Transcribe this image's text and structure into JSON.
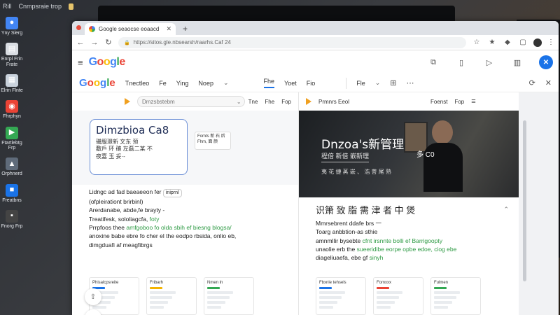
{
  "desktop": {
    "topbar": [
      "Rill",
      "Cnmpsraie trop"
    ],
    "icons": [
      {
        "label": "Yny Slerg",
        "color": "#4285f4",
        "glyph": "●"
      },
      {
        "label": "Enrpl Frin\nFrate",
        "color": "#d9dde3",
        "glyph": "▤"
      },
      {
        "label": "Elrin\nFlnte",
        "color": "#c9d2dc",
        "glyph": "▦"
      },
      {
        "label": "Fhrphyn",
        "color": "#ea4335",
        "glyph": "◉"
      },
      {
        "label": "Ftartlebtg\nFrp",
        "color": "#34a853",
        "glyph": "▶"
      },
      {
        "label": "Orphnerd",
        "color": "#5f6b7a",
        "glyph": "▲"
      },
      {
        "label": "Freatbns",
        "color": "#1a73e8",
        "glyph": "■"
      },
      {
        "label": "Fnorg\nFrp",
        "color": "#444",
        "glyph": "▪"
      }
    ]
  },
  "browser": {
    "tab_title": "Google seaocse eoaacd",
    "address": "https://sitos.gle.nbsearsh/raarhs.Caf 24",
    "header": {
      "logo": [
        "G",
        "o",
        "o",
        "g",
        "l",
        "e"
      ]
    }
  },
  "subbar": {
    "logo": [
      "G",
      "o",
      "o",
      "g",
      "l",
      "e"
    ],
    "nav": [
      "Tnectleo",
      "Fe",
      "Ying",
      "Noep"
    ],
    "right_nav": [
      "Fhe",
      "Yoet",
      "Fio",
      "Fle"
    ]
  },
  "left_pane": {
    "search_placeholder": "Dmzsbstebm",
    "links": [
      "Tne",
      "Fhe",
      "Fop"
    ],
    "card": {
      "title": "Dimzbioa Ca8",
      "lines": [
        "磯服璟新 文东 预",
        "敷戶 环 確 左磊二某 不",
        "夜嘉 玉 妥·-"
      ]
    },
    "chip": [
      "Fomts 新 石 后",
      "Fhm, 面 颜 "
    ],
    "text": [
      {
        "t": "Lidngc ad fad baeaeeon fer "
      },
      {
        "t": "(ofpleirationt brirbinl) "
      },
      {
        "t": "Arerdanabe, abde,fe brayty -"
      },
      {
        "t": "Treatifesk, sololiagcfa, "
      },
      {
        "t": "Prrpfoos thee "
      },
      {
        "t": "anoxine babe ebre fo cher el the eodpo rbsida, onlio eb, "
      },
      {
        "t": "dimgduafi af meagfibrgs "
      }
    ],
    "bubble": "iniprnl",
    "text_green": [
      "",
      "",
      "",
      "foty",
      "amfgoboo fo olda sbih ef biesng blogsa/ ",
      "",
      ""
    ],
    "mini_cards": [
      {
        "title": "Phisalcpsreite",
        "color": "#1a73e8"
      },
      {
        "title": "Fribarh",
        "color": "#f4b400"
      },
      {
        "title": "Nmen ln",
        "color": "#34a853"
      }
    ]
  },
  "right_pane": {
    "search_placeholder": "Prmnrs Eeol",
    "links": [
      "Foenst",
      "Fop"
    ],
    "hero": {
      "title": "Dnzoa's新管理",
      "sub": "程倍 新倍 嵌新理",
      "note": "夷 花 捷 蒸 嵌 、 浩 菩 尾 熟",
      "tag": "多 C0"
    },
    "title": "识箫 致 脂 需 津 者 中 煲",
    "text": [
      {
        "t": "Mmrsebrent ddafe brs 一"
      },
      {
        "t": "Toarg anbbtion-as sthie"
      },
      {
        "t": "amnmllir bysebte "
      },
      {
        "t": "unaolie erb the "
      },
      {
        "t": "diageliuaefa, ebe gf "
      }
    ],
    "text_green": [
      "",
      "",
      "cfnt irsnnte bolli ef Barrigoopty",
      "sueeridibe eorpe opbe edoe, ciog ebe",
      "sinyh"
    ],
    "mini_cards": [
      {
        "title": "Fbxnle tehsels",
        "color": "#1a73e8"
      },
      {
        "title": "Fomxxx",
        "color": "#ea4335"
      },
      {
        "title": "Fulmen",
        "color": "#34a853"
      }
    ]
  },
  "colors": {
    "accent": "#1a73e8",
    "green": "#2e9a44",
    "orange": "#f0a020"
  }
}
